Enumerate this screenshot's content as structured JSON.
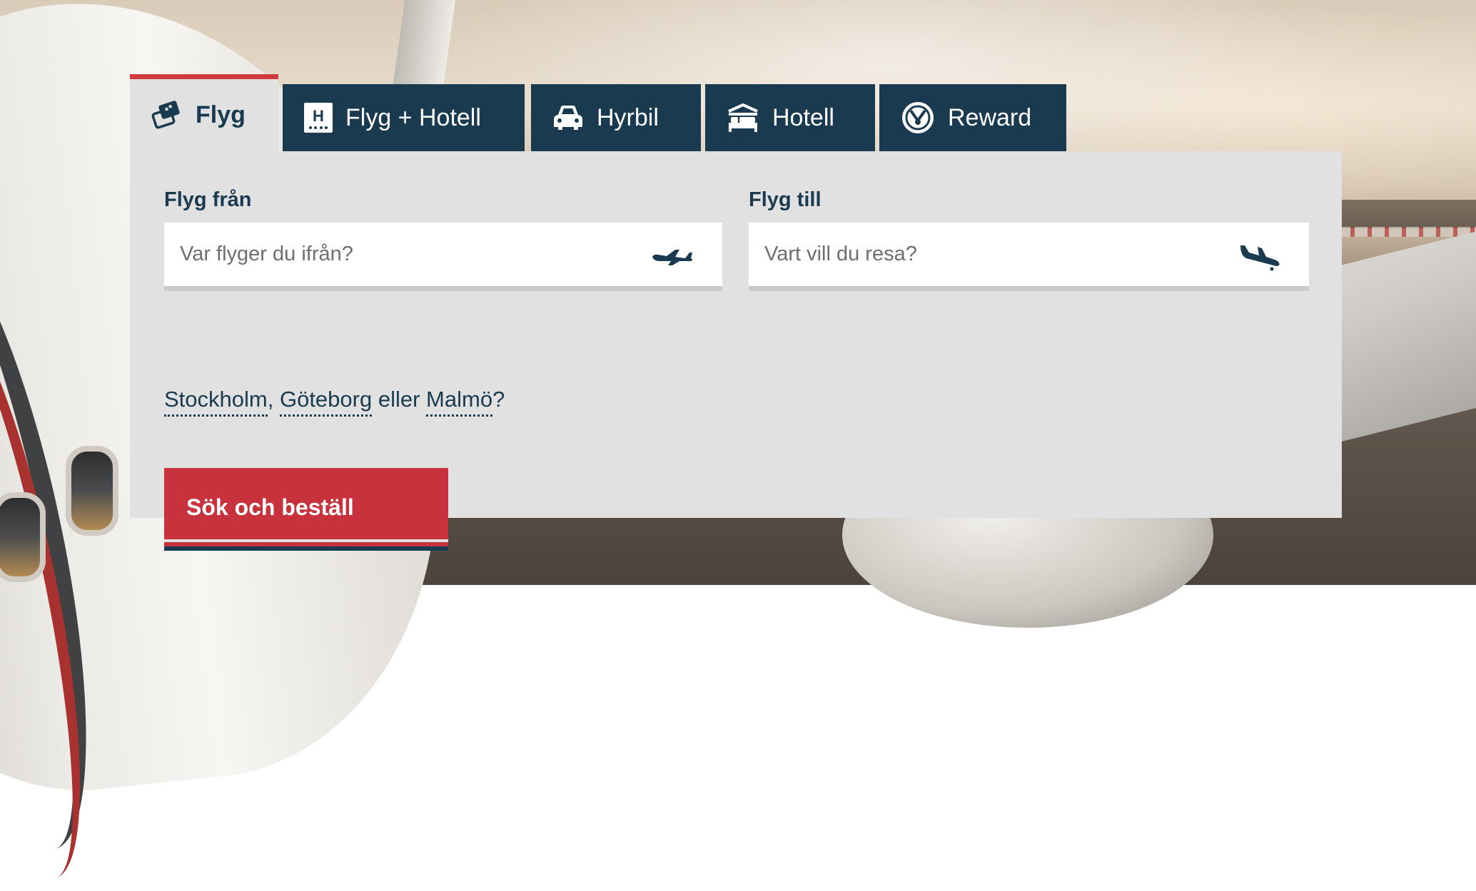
{
  "tabs": [
    {
      "label": "Flyg",
      "icon": "ticket-icon",
      "active": true
    },
    {
      "label": "Flyg + Hotell",
      "icon": "hotel-h-icon",
      "active": false
    },
    {
      "label": "Hyrbil",
      "icon": "car-icon",
      "active": false
    },
    {
      "label": "Hotell",
      "icon": "bed-icon",
      "active": false
    },
    {
      "label": "Reward",
      "icon": "reward-badge-icon",
      "active": false
    }
  ],
  "form": {
    "from_label": "Flyg från",
    "from_placeholder": "Var flyger du ifrån?",
    "from_icon": "plane-takeoff-icon",
    "to_label": "Flyg till",
    "to_placeholder": "Vart vill du resa?",
    "to_icon": "plane-landing-icon"
  },
  "suggestions": {
    "city1": "Stockholm",
    "sep1": ", ",
    "city2": "Göteborg",
    "sep2": " eller ",
    "city3": "Malmö",
    "suffix": "?"
  },
  "search_button": "Sök och beställ",
  "colors": {
    "navy": "#1a3b4f",
    "red": "#c8323d",
    "panel": "#e1e1e1"
  }
}
